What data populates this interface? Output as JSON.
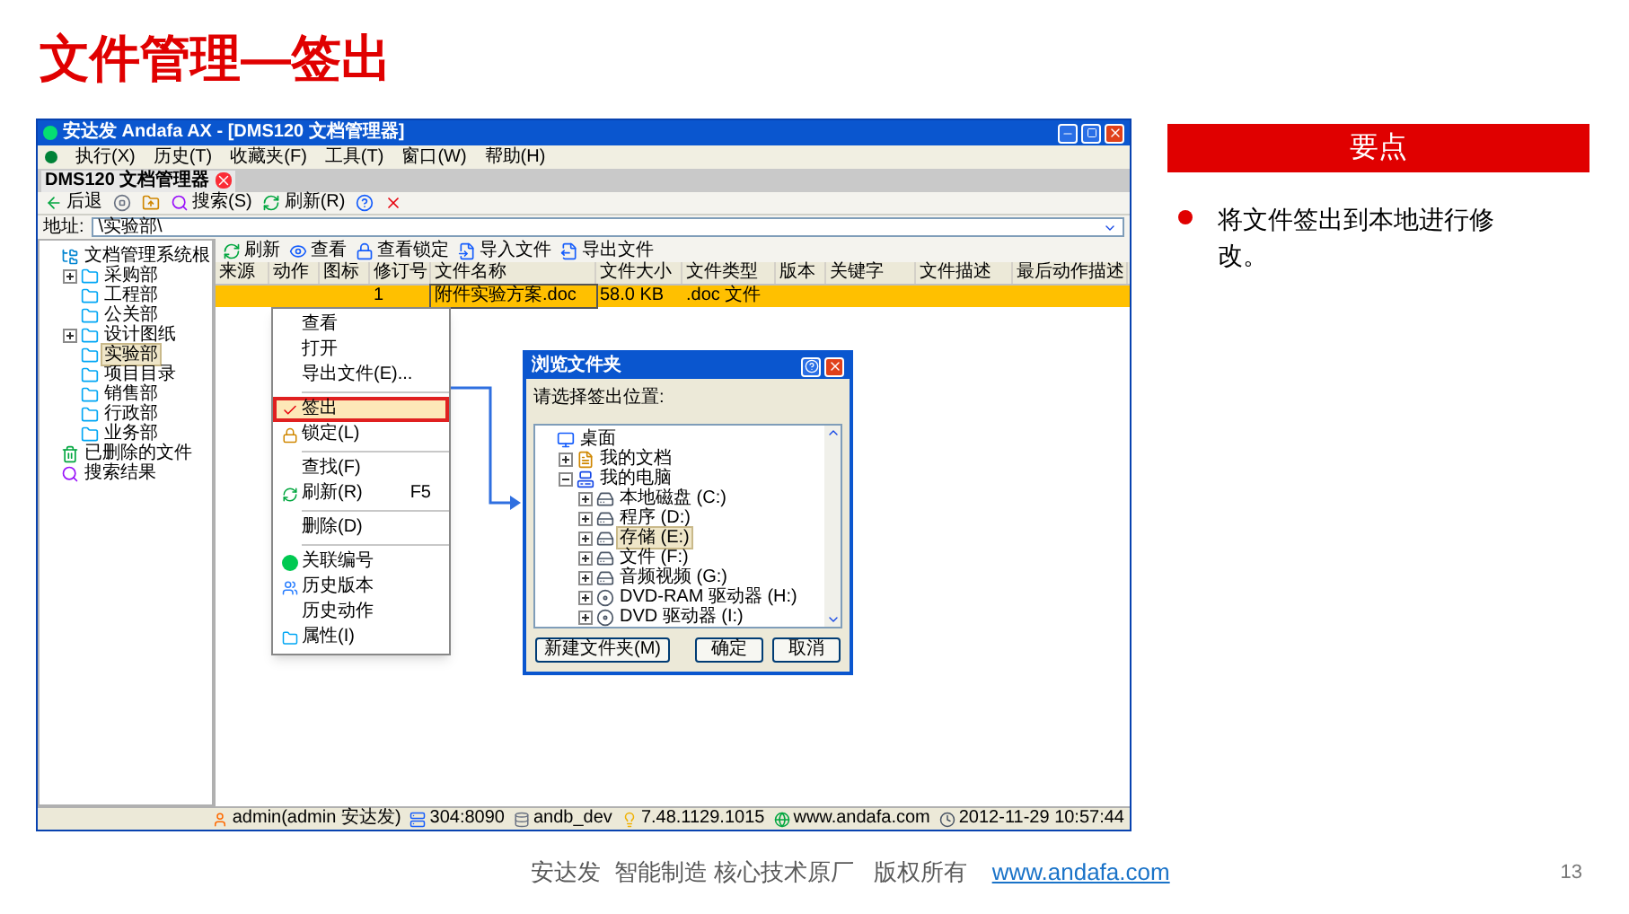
{
  "slide": {
    "title": "文件管理—签出",
    "footer_text": "安达发  智能制造 核心技术原厂   版权所有",
    "footer_link": "www.andafa.com",
    "page_number": "13"
  },
  "app": {
    "title": "安达发 Andafa AX - [DMS120 文档管理器]",
    "menu": [
      "执行(X)",
      "历史(T)",
      "收藏夹(F)",
      "工具(T)",
      "窗口(W)",
      "帮助(H)"
    ],
    "doc_tab": "DMS120 文档管理器",
    "toolbar": [
      {
        "kind": "back",
        "label": "后退"
      },
      {
        "kind": "stop"
      },
      {
        "kind": "up"
      },
      {
        "kind": "search",
        "label": "搜索(S)"
      },
      {
        "kind": "refresh",
        "label": "刷新(R)"
      },
      {
        "kind": "help"
      },
      {
        "kind": "close"
      }
    ],
    "address": {
      "label": "地址:",
      "value": "\\实验部\\"
    },
    "tree": [
      {
        "kind": "root",
        "label": "文档管理系统根",
        "selected": false,
        "children": [
          {
            "kind": "folder",
            "label": "采购部",
            "selected": false,
            "expanded": false
          },
          {
            "kind": "folder",
            "label": "工程部",
            "selected": false
          },
          {
            "kind": "folder",
            "label": "公关部",
            "selected": false
          },
          {
            "kind": "folder",
            "label": "设计图纸",
            "selected": false,
            "expanded": false
          },
          {
            "kind": "folder",
            "label": "实验部",
            "selected": true
          },
          {
            "kind": "folder",
            "label": "项目目录",
            "selected": false
          },
          {
            "kind": "folder",
            "label": "销售部",
            "selected": false
          },
          {
            "kind": "folder",
            "label": "行政部",
            "selected": false
          },
          {
            "kind": "folder",
            "label": "业务部",
            "selected": false
          }
        ]
      },
      {
        "kind": "trash",
        "label": "已删除的文件",
        "selected": false
      },
      {
        "kind": "search",
        "label": "搜索结果",
        "selected": false
      }
    ],
    "file_toolbar": [
      {
        "kind": "refresh",
        "label": "刷新"
      },
      {
        "kind": "view",
        "label": "查看"
      },
      {
        "kind": "view-lock",
        "label": "查看锁定"
      },
      {
        "kind": "import",
        "label": "导入文件"
      },
      {
        "kind": "export",
        "label": "导出文件"
      }
    ],
    "columns": [
      "来源",
      "动作",
      "图标",
      "修订号",
      "文件名称",
      "文件大小",
      "文件类型",
      "版本",
      "关键字",
      "文件描述",
      "最后动作描述"
    ],
    "rows": [
      {
        "selected": true,
        "cells": [
          "",
          "",
          "",
          "1",
          "附件实验方案.doc",
          "58.0 KB",
          ".doc 文件",
          "",
          "",
          "",
          ""
        ]
      }
    ],
    "context_menu": [
      {
        "kind": "item",
        "label": "查看"
      },
      {
        "kind": "item",
        "label": "打开"
      },
      {
        "kind": "item",
        "label": "导出文件(E)..."
      },
      {
        "kind": "separator"
      },
      {
        "kind": "item",
        "label": "签出",
        "highlighted": true
      },
      {
        "kind": "item",
        "label": "锁定(L)"
      },
      {
        "kind": "separator"
      },
      {
        "kind": "item",
        "label": "查找(F)"
      },
      {
        "kind": "item",
        "label": "刷新(R)",
        "shortcut": "F5"
      },
      {
        "kind": "separator"
      },
      {
        "kind": "item",
        "label": "删除(D)"
      },
      {
        "kind": "separator"
      },
      {
        "kind": "item",
        "label": "关联编号"
      },
      {
        "kind": "item",
        "label": "历史版本"
      },
      {
        "kind": "item",
        "label": "历史动作"
      },
      {
        "kind": "item",
        "label": "属性(I)"
      }
    ],
    "dialog": {
      "title": "浏览文件夹",
      "prompt": "请选择签出位置:",
      "tree": [
        {
          "kind": "desktop",
          "label": "桌面",
          "selected": false,
          "children": [
            {
              "kind": "documents",
              "label": "我的文档",
              "selected": false,
              "expanded": false
            },
            {
              "kind": "computer",
              "label": "我的电脑",
              "selected": false,
              "expanded": true,
              "children": [
                {
                  "kind": "drive",
                  "label": "本地磁盘 (C:)",
                  "selected": false,
                  "expanded": false
                },
                {
                  "kind": "drive",
                  "label": "程序 (D:)",
                  "selected": false,
                  "expanded": false
                },
                {
                  "kind": "drive",
                  "label": "存储 (E:)",
                  "selected": true,
                  "expanded": false
                },
                {
                  "kind": "drive",
                  "label": "文件 (F:)",
                  "selected": false,
                  "expanded": false
                },
                {
                  "kind": "drive",
                  "label": "音频视频 (G:)",
                  "selected": false,
                  "expanded": false
                },
                {
                  "kind": "dvd",
                  "label": "DVD-RAM 驱动器 (H:)",
                  "selected": false,
                  "expanded": false
                },
                {
                  "kind": "dvd",
                  "label": "DVD 驱动器 (I:)",
                  "selected": false,
                  "expanded": false
                }
              ]
            }
          ]
        }
      ],
      "buttons": [
        "新建文件夹(M)",
        "确定",
        "取消"
      ]
    },
    "status": [
      "admin(admin 安达发)",
      "304:8090",
      "andb_dev",
      "7.48.1129.1015",
      "www.andafa.com",
      "2012-11-29 10:57:44"
    ]
  },
  "key_points": {
    "title": "要点",
    "items": [
      "将文件签出到本地进行修改。"
    ]
  }
}
